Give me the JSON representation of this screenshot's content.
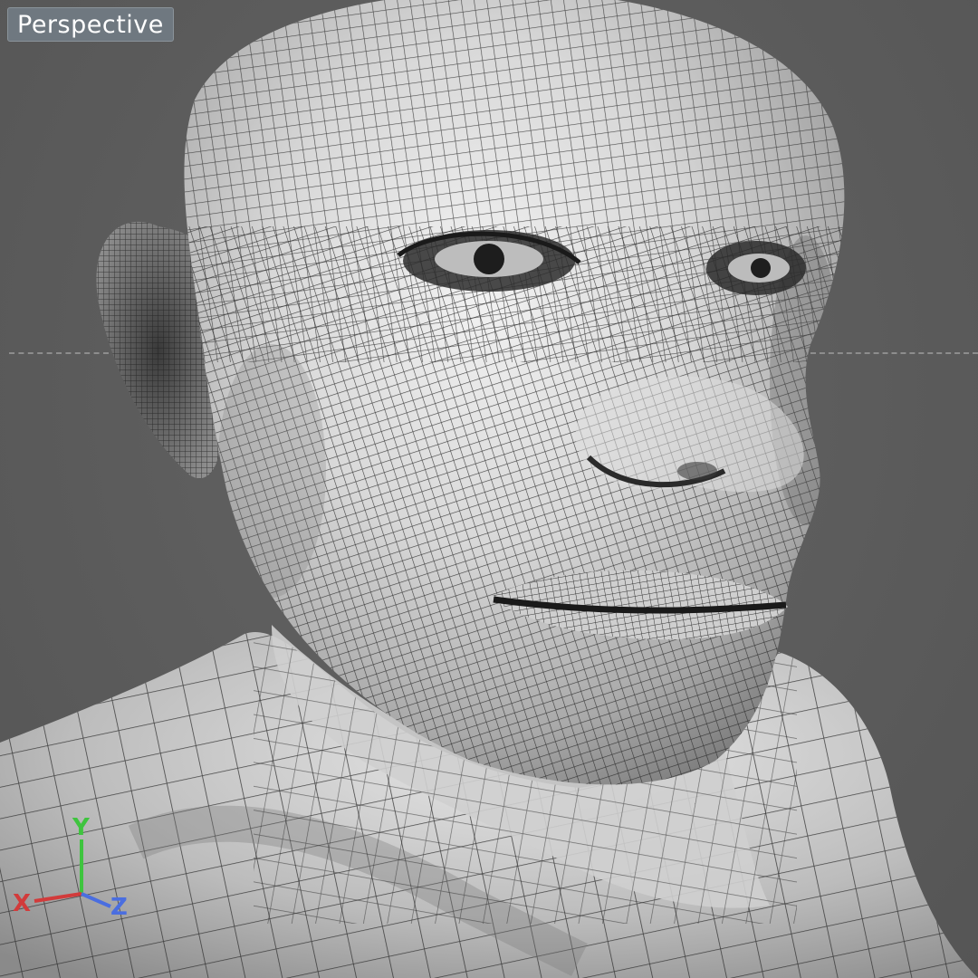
{
  "viewport": {
    "view_name": "Perspective",
    "background_color": "#5e5e5e",
    "shading": "wireframe-on-shaded"
  },
  "axis_gizmo": {
    "x_label": "X",
    "y_label": "Y",
    "z_label": "Z",
    "x_color": "#d23b3b",
    "y_color": "#3ec43e",
    "z_color": "#4a6ee0"
  },
  "model": {
    "subject": "human-head-mesh",
    "mesh_color": "#e6e6e6",
    "wire_color": "#2a2a2a"
  }
}
